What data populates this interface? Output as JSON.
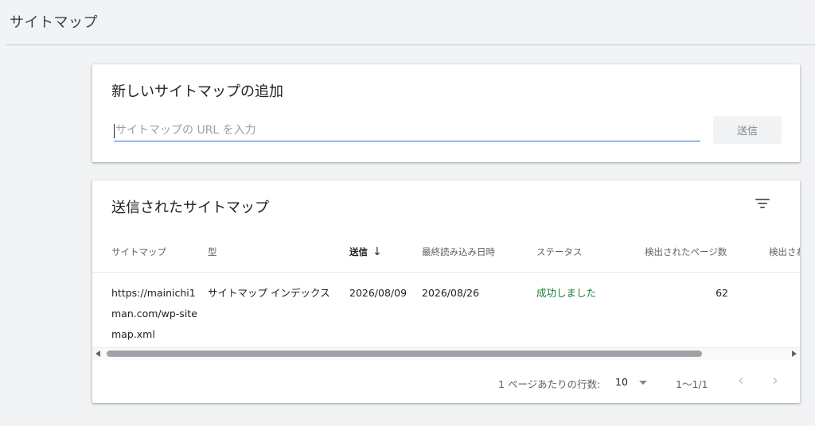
{
  "page": {
    "title": "サイトマップ"
  },
  "add_card": {
    "title": "新しいサイトマップの追加",
    "input_placeholder": "サイトマップの URL を入力",
    "input_value": "",
    "submit_label": "送信"
  },
  "list_card": {
    "title": "送信されたサイトマップ",
    "columns": {
      "sitemap": "サイトマップ",
      "type": "型",
      "submitted": "送信",
      "last_read": "最終読み込み日時",
      "status": "ステータス",
      "pages": "検出されたページ数",
      "more": "検出され"
    },
    "sort_arrow": "↓",
    "rows": [
      {
        "sitemap": "https://mainichi1man.com/wp-sitemap.xml",
        "type": "サイトマップ インデックス",
        "submitted": "2026/08/09",
        "last_read": "2026/08/26",
        "status": "成功しました",
        "pages": "62"
      }
    ],
    "pager": {
      "rows_per_page_label": "1 ページあたりの行数:",
      "rows_per_page": "10",
      "range": "1〜1/1",
      "prev": "‹",
      "next": "›"
    }
  },
  "colors": {
    "accent": "#1a73e8",
    "success": "#188038",
    "background": "#f1f3f4"
  },
  "icons": {
    "filter": "filter-list-icon",
    "sort": "arrow-down-icon"
  }
}
